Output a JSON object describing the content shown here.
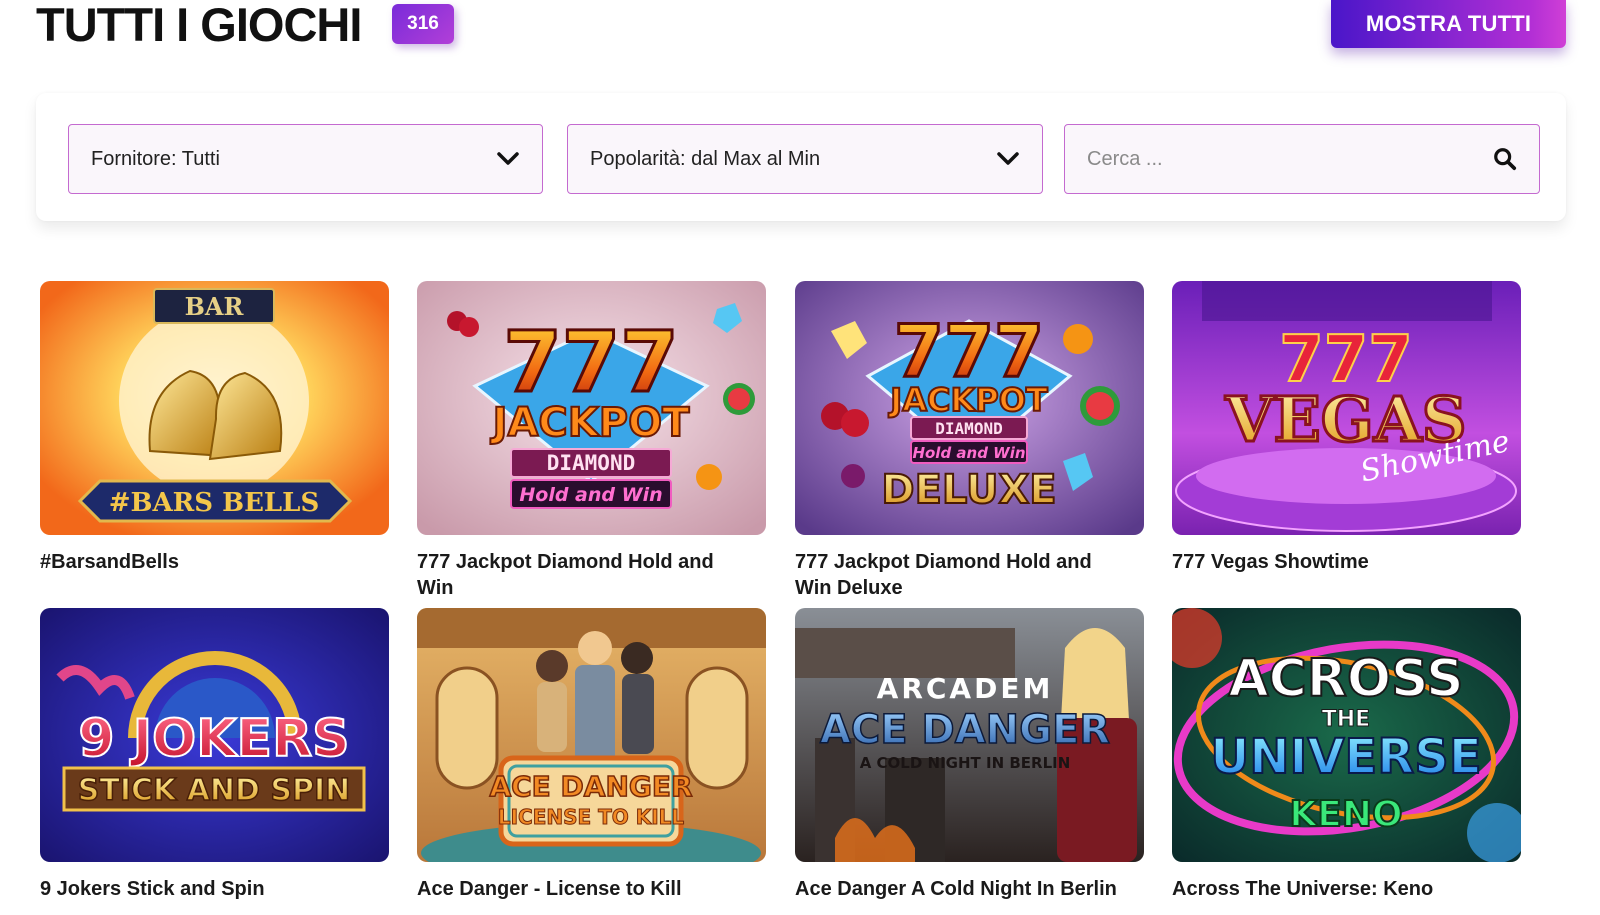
{
  "header": {
    "title": "TUTTI I GIOCHI",
    "count": "316",
    "show_all_label": "MOSTRA TUTTI"
  },
  "filters": {
    "provider_label": "Fornitore: Tutti",
    "sort_label": "Popolarità: dal Max al Min",
    "search_placeholder": "Cerca ..."
  },
  "games": [
    {
      "title": "#BarsandBells",
      "art_lines": [
        "BAR",
        "#BARS BELLS"
      ]
    },
    {
      "title": "777 Jackpot Diamond Hold and Win",
      "art_lines": [
        "777",
        "JACKPOT",
        "DIAMOND",
        "Hold and Win"
      ]
    },
    {
      "title": "777 Jackpot Diamond Hold and Win Deluxe",
      "art_lines": [
        "777",
        "JACKPOT",
        "DIAMOND",
        "Hold and Win",
        "DELUXE"
      ]
    },
    {
      "title": "777 Vegas Showtime",
      "art_lines": [
        "777",
        "VEGAS",
        "Showtime"
      ]
    },
    {
      "title": "9 Jokers Stick and Spin",
      "art_lines": [
        "9 JOKERS",
        "STICK AND SPIN"
      ]
    },
    {
      "title": "Ace Danger - License to Kill",
      "art_lines": [
        "ACE DANGER",
        "LICENSE TO KILL"
      ]
    },
    {
      "title": "Ace Danger A Cold Night In Berlin",
      "art_lines": [
        "ARCADEM",
        "ACE DANGER",
        "A COLD NIGHT IN BERLIN"
      ]
    },
    {
      "title": "Across The Universe: Keno",
      "art_lines": [
        "ACROSS",
        "THE",
        "UNIVERSE",
        "KENO"
      ]
    }
  ]
}
